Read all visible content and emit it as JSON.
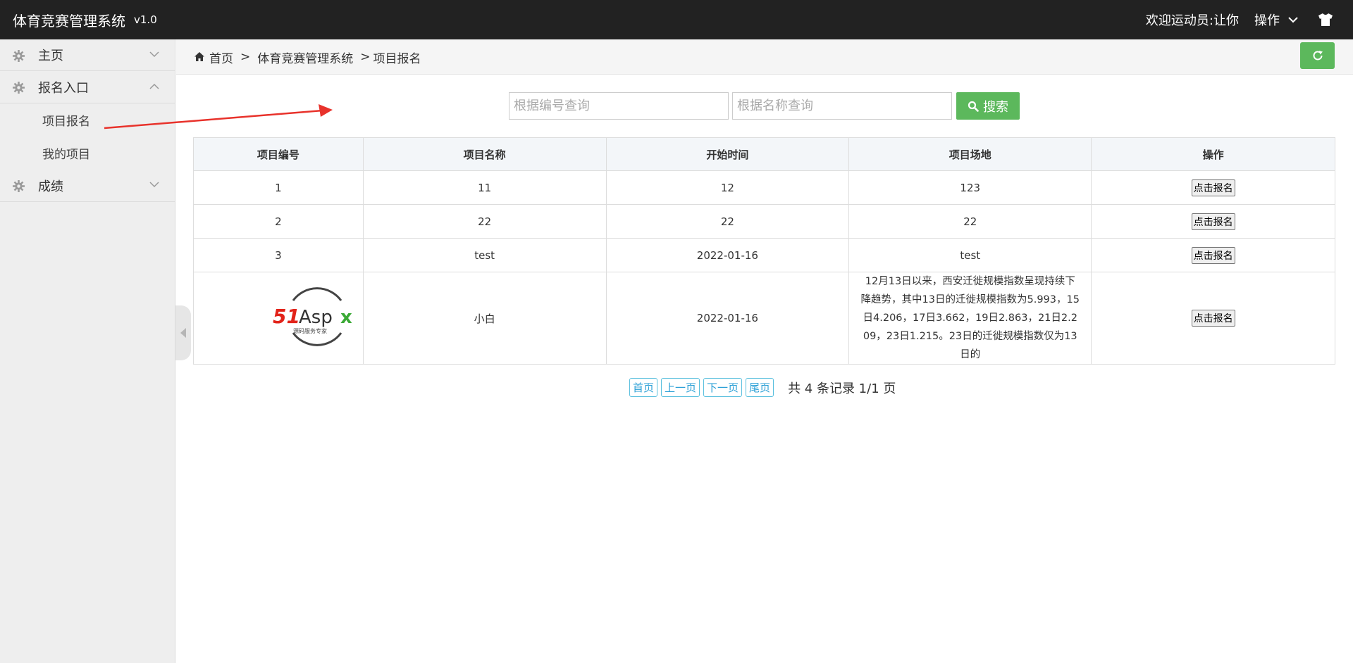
{
  "header": {
    "title": "体育竞赛管理系统",
    "version": "v1.0",
    "welcome": "欢迎运动员:让你",
    "ops_label": "操作"
  },
  "sidebar": {
    "groups": [
      {
        "label": "主页",
        "expanded": false
      },
      {
        "label": "报名入口",
        "expanded": true,
        "items": [
          "项目报名",
          "我的项目"
        ]
      },
      {
        "label": "成绩",
        "expanded": false
      }
    ]
  },
  "breadcrumb": [
    "首页",
    "体育竞赛管理系统",
    "项目报名"
  ],
  "search": {
    "code_placeholder": "根据编号查询",
    "name_placeholder": "根据名称查询",
    "button": "搜索"
  },
  "table": {
    "headers": [
      "项目编号",
      "项目名称",
      "开始时间",
      "项目场地",
      "操作"
    ],
    "rows": [
      {
        "id": "1",
        "name": "11",
        "start": "12",
        "venue": "123",
        "action": "点击报名"
      },
      {
        "id": "2",
        "name": "22",
        "start": "22",
        "venue": "22",
        "action": "点击报名"
      },
      {
        "id": "3",
        "name": "test",
        "start": "2022-01-16",
        "venue": "test",
        "action": "点击报名"
      },
      {
        "id": "",
        "logo_text": "51Aspx",
        "logo_sub": "源码服务专家",
        "name": "小白",
        "start": "2022-01-16",
        "venue": "12月13日以来，西安迁徙规模指数呈现持续下降趋势，其中13日的迁徙规模指数为5.993，15日4.206，17日3.662，19日2.863，21日2.209，23日1.215。23日的迁徙规模指数仅为13日的",
        "action": "点击报名"
      }
    ]
  },
  "pager": {
    "first": "首页",
    "prev": "上一页",
    "next": "下一页",
    "last": "尾页",
    "info": "共 4 条记录 1/1 页"
  },
  "colors": {
    "topbar": "#222222",
    "sidebar": "#eeeeee",
    "success": "#5cb85c",
    "pager_border": "#5bc0de",
    "annotation_arrow": "#e8322b",
    "logo_red": "#e2231a",
    "logo_green": "#3aa935"
  }
}
